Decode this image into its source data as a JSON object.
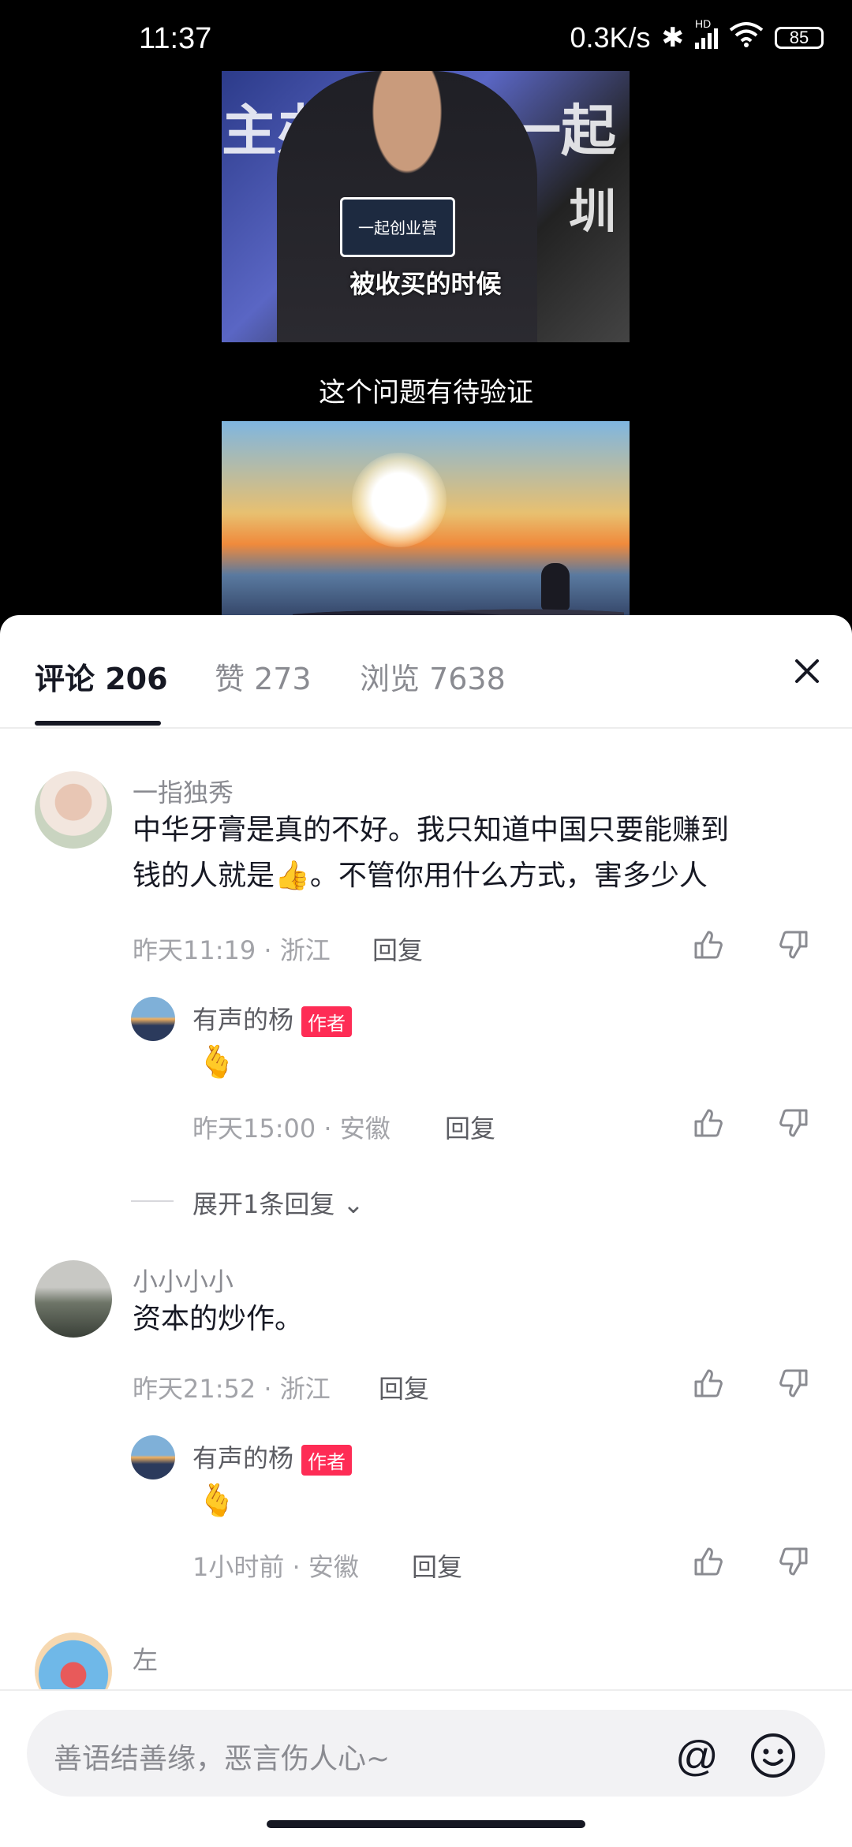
{
  "status": {
    "time": "11:37",
    "speed": "0.3K/s",
    "network": "HD",
    "battery": "85"
  },
  "video": {
    "frame1_bg_text_left": "主办",
    "frame1_bg_text_right": "一起",
    "frame1_bg_text_right2": "圳",
    "frame1_mic_text": "一起创业营",
    "frame1_caption": "被收买的时候",
    "subtitle": "这个问题有待验证"
  },
  "tabs": [
    {
      "label": "评论 206"
    },
    {
      "label": "赞 273"
    },
    {
      "label": "浏览 7638"
    }
  ],
  "comments": [
    {
      "user": "一指独秀",
      "text_line1": "中华牙膏是真的不好。我只知道中国只要能赚到",
      "text_line2a": "钱的人就是",
      "text_line2b": "👍",
      "text_line2c": "。不管你用什么方式，害多少人",
      "meta": "昨天11:19 · 浙江",
      "reply": "回复",
      "replies": [
        {
          "user": "有声的杨",
          "tag": "作者",
          "text": "🫰",
          "meta": "昨天15:00 · 安徽",
          "reply": "回复"
        }
      ],
      "expand": "展开1条回复"
    },
    {
      "user": "小小小小",
      "text": "资本的炒作。",
      "meta": "昨天21:52 · 浙江",
      "reply": "回复",
      "replies": [
        {
          "user": "有声的杨",
          "tag": "作者",
          "text": "🫰",
          "meta": "1小时前 · 安徽",
          "reply": "回复"
        }
      ]
    },
    {
      "user": "左"
    }
  ],
  "input": {
    "placeholder": "善语结善缘，恶言伤人心~"
  },
  "colors": {
    "accent": "#fe2c55",
    "text": "#161823",
    "muted": "#8a8b91"
  }
}
